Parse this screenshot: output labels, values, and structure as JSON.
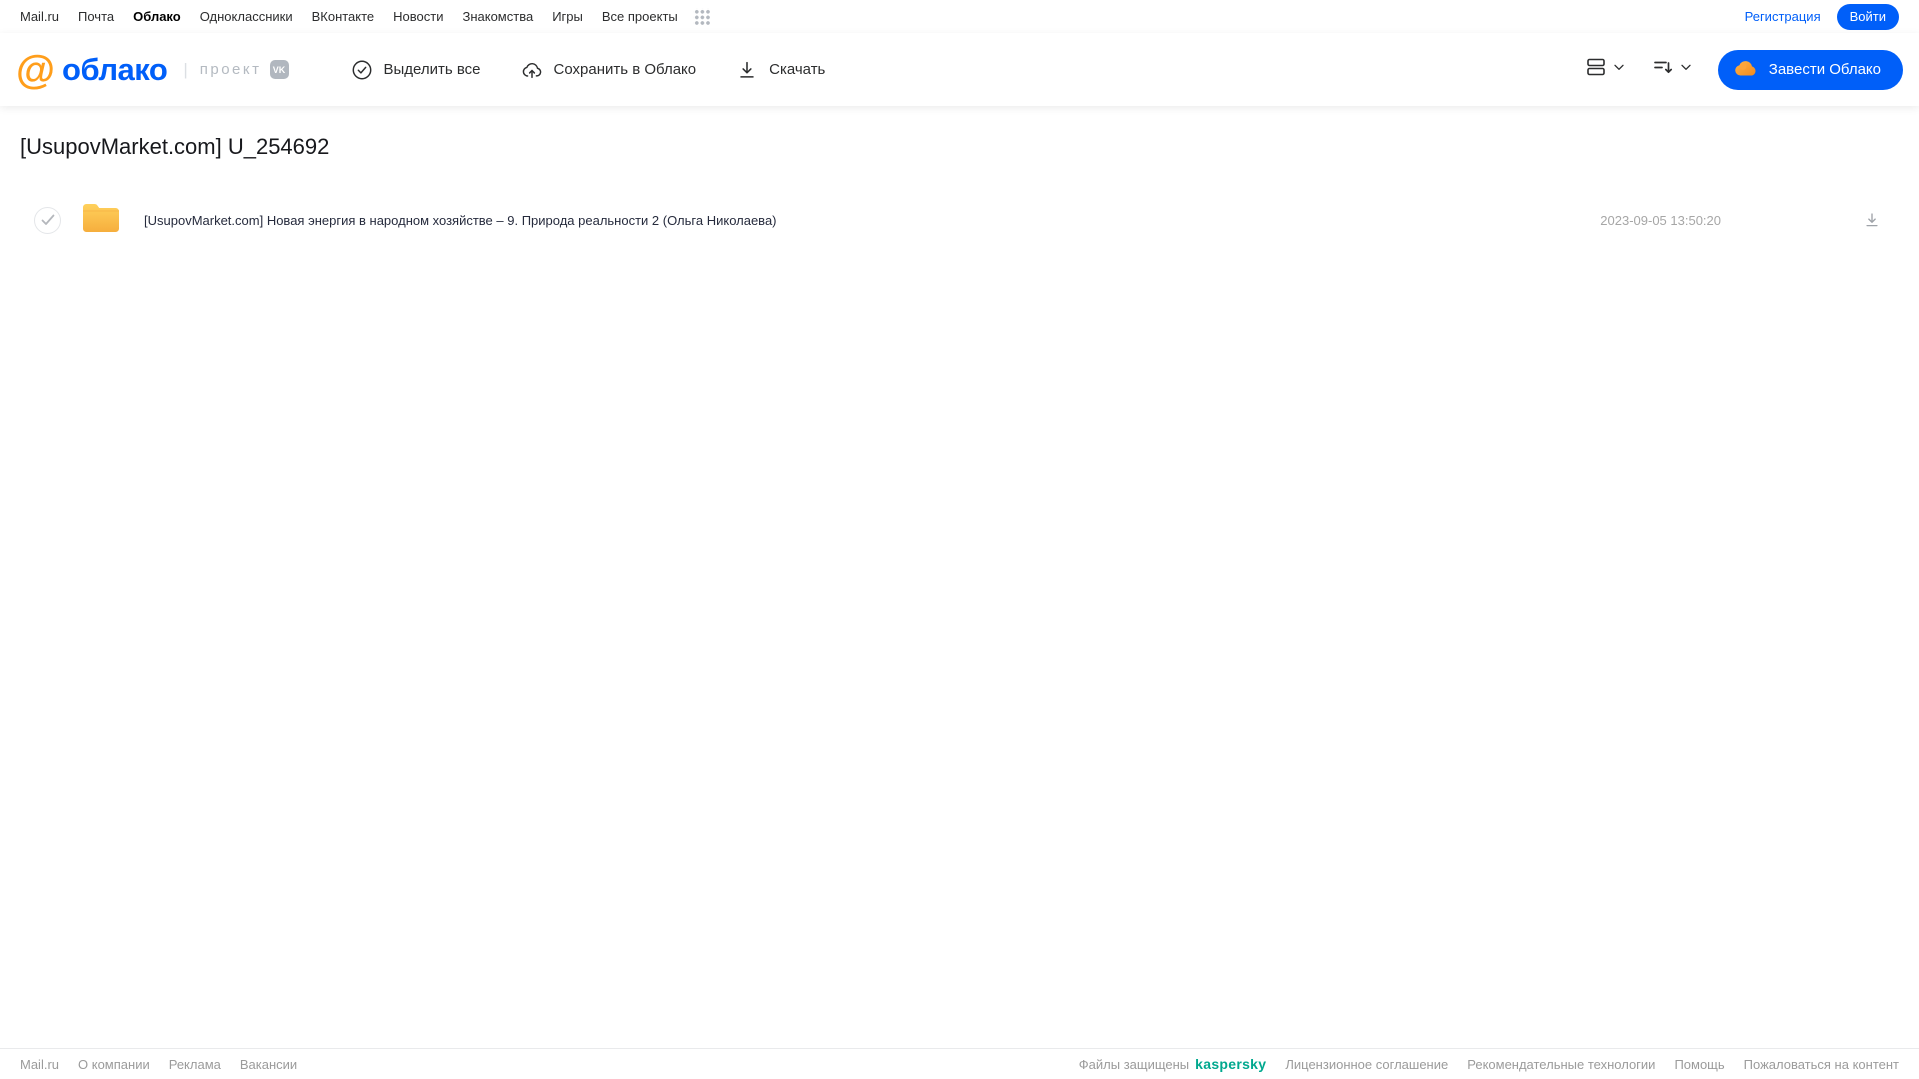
{
  "topbar": {
    "links": [
      "Mail.ru",
      "Почта",
      "Облако",
      "Одноклассники",
      "ВКонтакте",
      "Новости",
      "Знакомства",
      "Игры",
      "Все проекты"
    ],
    "registration": "Регистрация",
    "login": "Войти"
  },
  "header": {
    "logo": {
      "at": "@",
      "name": "облако",
      "separator": "|",
      "project": "проект",
      "vk_badge": "vk"
    },
    "toolbar": {
      "select_all": "Выделить все",
      "save_to_cloud": "Сохранить в Облако",
      "download": "Скачать"
    },
    "create_cloud_button": "Завести Облако"
  },
  "main": {
    "title": "[UsupovMarket.com] U_254692",
    "files": [
      {
        "name": "[UsupovMarket.com] Новая энергия в народном хозяйстве – 9. Природа реальности 2 (Ольга Николаева)",
        "date": "2023-09-05 13:50:20"
      }
    ]
  },
  "footer": {
    "left_links": [
      "Mail.ru",
      "О компании",
      "Реклама",
      "Вакансии"
    ],
    "protected_text": "Файлы защищены",
    "kaspersky_brand": "kaspersky",
    "right_links": [
      "Лицензионное соглашение",
      "Рекомендательные технологии",
      "Помощь",
      "Пожаловаться на контент"
    ]
  },
  "colors": {
    "accent_blue": "#005ff9",
    "logo_orange": "#ff9e1b",
    "folder_yellow": "#f8bc45",
    "kaspersky_green": "#00a88e",
    "muted_gray": "#9b9b9b"
  }
}
